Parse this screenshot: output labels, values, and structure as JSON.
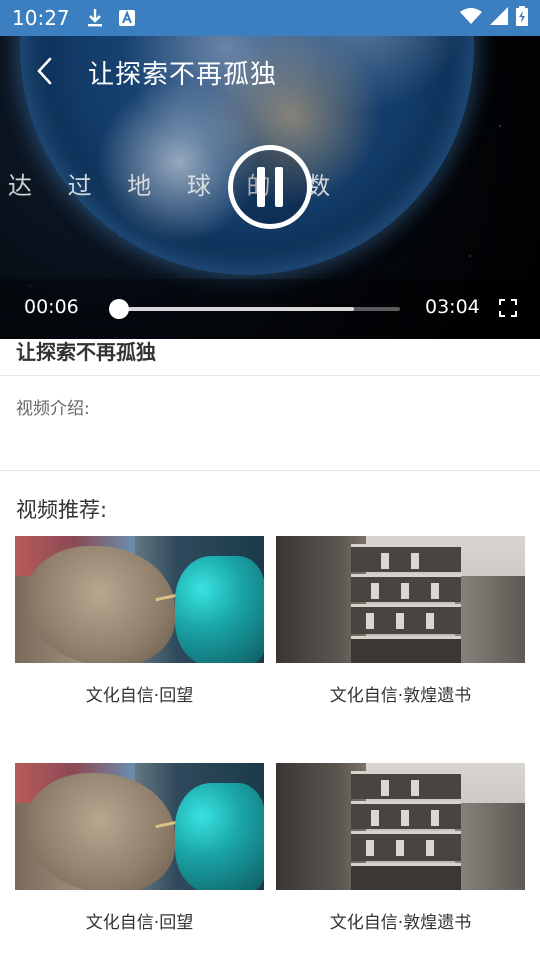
{
  "status_bar": {
    "time": "10:27",
    "icons": [
      "download-icon",
      "text-a-icon",
      "wifi-icon",
      "signal-icon",
      "battery-icon"
    ],
    "background": "#3b7fc0"
  },
  "player": {
    "title": "让探索不再孤独",
    "subtitle": "达 过 地 球 的   数",
    "current_time": "00:06",
    "total_time": "03:04",
    "progress_fraction": 0.03,
    "buffered_fraction": 0.84,
    "state": "playing"
  },
  "content": {
    "title": "让探索不再孤独",
    "intro_label": "视频介绍:"
  },
  "recommendations": {
    "header": "视频推荐:",
    "items": [
      {
        "label": "文化自信·回望",
        "thumbnail": "buddha-restoration"
      },
      {
        "label": "文化自信·敦煌遗书",
        "thumbnail": "cave-temple"
      },
      {
        "label": "文化自信·回望",
        "thumbnail": "buddha-restoration"
      },
      {
        "label": "文化自信·敦煌遗书",
        "thumbnail": "cave-temple"
      }
    ]
  }
}
